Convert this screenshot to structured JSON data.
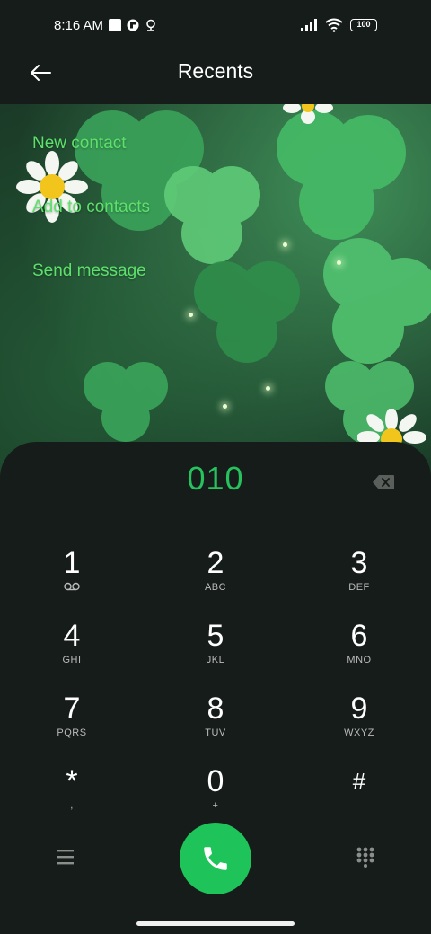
{
  "status_bar": {
    "time": "8:16 AM",
    "battery": "100"
  },
  "header": {
    "title": "Recents"
  },
  "actions": [
    {
      "label": "New contact"
    },
    {
      "label": "Add to contacts"
    },
    {
      "label": "Send message"
    }
  ],
  "dialer": {
    "number": "010",
    "keys": [
      {
        "digit": "1",
        "letters": ""
      },
      {
        "digit": "2",
        "letters": "ABC"
      },
      {
        "digit": "3",
        "letters": "DEF"
      },
      {
        "digit": "4",
        "letters": "GHI"
      },
      {
        "digit": "5",
        "letters": "JKL"
      },
      {
        "digit": "6",
        "letters": "MNO"
      },
      {
        "digit": "7",
        "letters": "PQRS"
      },
      {
        "digit": "8",
        "letters": "TUV"
      },
      {
        "digit": "9",
        "letters": "WXYZ"
      },
      {
        "digit": "*",
        "letters": ","
      },
      {
        "digit": "0",
        "letters": "+"
      },
      {
        "digit": "#",
        "letters": ""
      }
    ]
  },
  "icons": {
    "back": "back-arrow-icon",
    "backspace": "backspace-icon",
    "voicemail": "voicemail-icon",
    "call": "phone-icon",
    "menu": "menu-icon",
    "keypad": "keypad-icon"
  },
  "colors": {
    "accent": "#27c25d",
    "action_text": "#5ee06c",
    "panel_bg": "#161c1a",
    "call_button": "#1ec45a"
  }
}
